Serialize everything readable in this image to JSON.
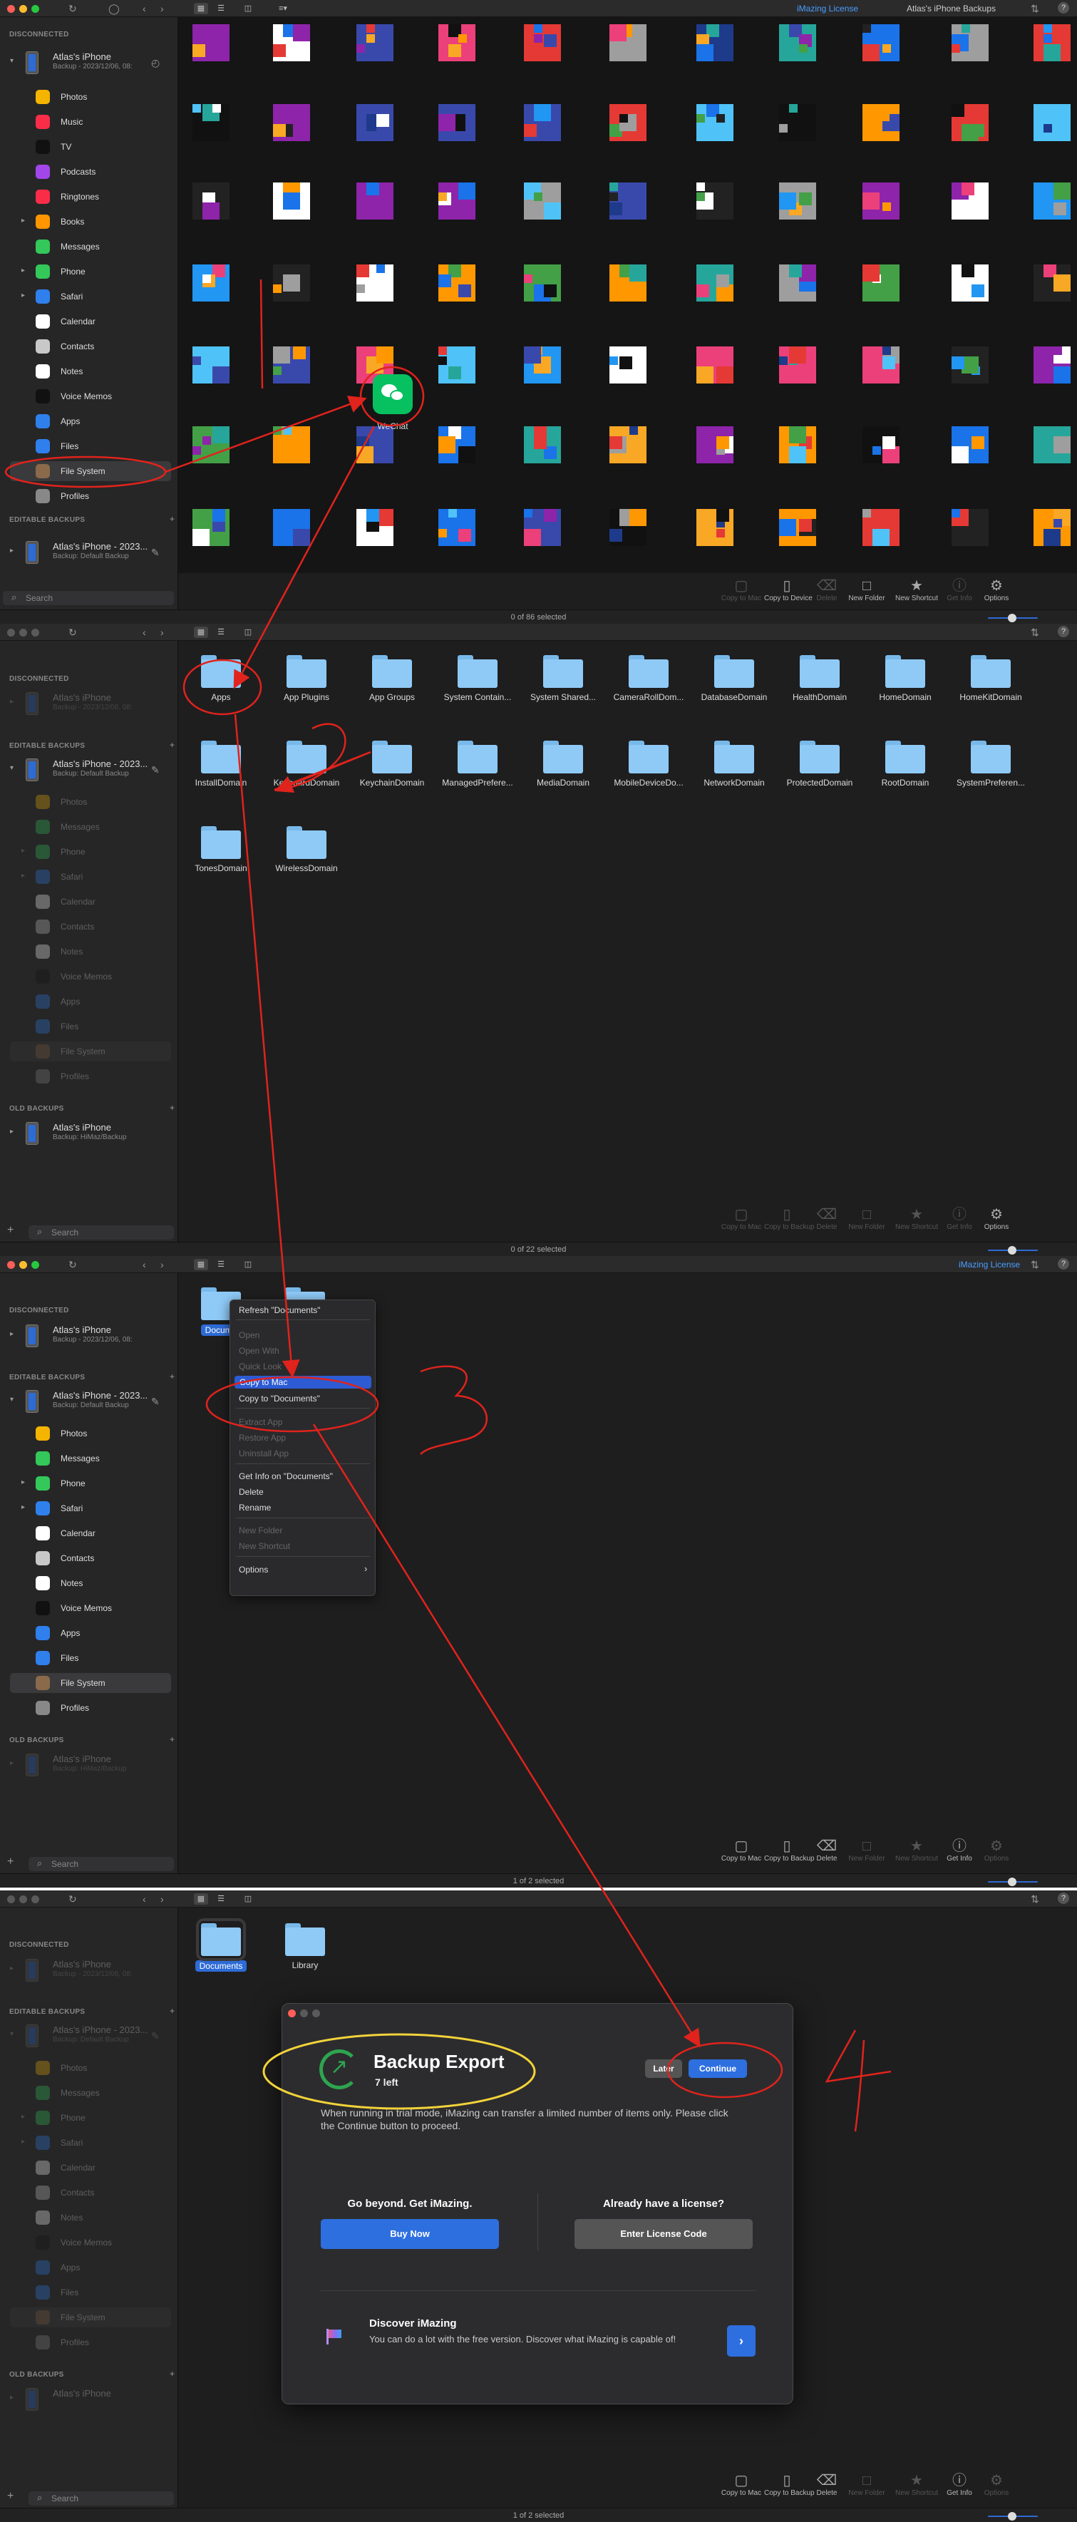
{
  "titlebar": {
    "license_link": "iMazing License",
    "backups_label": "Atlas's iPhone Backups",
    "help": "?"
  },
  "sidebar": {
    "disconnected_header": "DISCONNECTED",
    "editable_header": "EDITABLE BACKUPS",
    "old_header": "OLD BACKUPS",
    "device_name": "Atlas's iPhone",
    "device_sub": "Backup - 2023/12/06, 08:",
    "backup_name": "Atlas's iPhone - 2023...",
    "backup_sub": "Backup: Default Backup",
    "old_name": "Atlas's iPhone",
    "old_sub": "Backup: HiMaz/Backup",
    "search_placeholder": "Search",
    "items_full": [
      "Photos",
      "Music",
      "TV",
      "Podcasts",
      "Ringtones",
      "Books",
      "Messages",
      "Phone",
      "Safari",
      "Calendar",
      "Contacts",
      "Notes",
      "Voice Memos",
      "Apps",
      "Files",
      "File System",
      "Profiles"
    ],
    "items_backup": [
      "Photos",
      "Messages",
      "Phone",
      "Safari",
      "Calendar",
      "Contacts",
      "Notes",
      "Voice Memos",
      "Apps",
      "Files",
      "File System",
      "Profiles"
    ]
  },
  "panel1": {
    "wechat_label": "WeChat",
    "status": "0 of 86 selected"
  },
  "panel2": {
    "folders": [
      "Apps",
      "App Plugins",
      "App Groups",
      "System Contain...",
      "System Shared...",
      "CameraRollDom...",
      "DatabaseDomain",
      "HealthDomain",
      "HomeDomain",
      "HomeKitDomain",
      "InstallDomain",
      "KeyboardDomain",
      "KeychainDomain",
      "ManagedPrefere...",
      "MediaDomain",
      "MobileDeviceDo...",
      "NetworkDomain",
      "ProtectedDomain",
      "RootDomain",
      "SystemPreferen...",
      "TonesDomain",
      "WirelessDomain"
    ],
    "status": "0 of 22 selected"
  },
  "panel3": {
    "selected_folder": "Docume",
    "context_menu": {
      "refresh": "Refresh \"Documents\"",
      "open": "Open",
      "open_with": "Open With",
      "quick_look": "Quick Look",
      "copy_to_mac": "Copy to Mac",
      "copy_to_documents": "Copy to \"Documents\"",
      "extract_app": "Extract App",
      "restore_app": "Restore App",
      "uninstall_app": "Uninstall App",
      "get_info": "Get Info on \"Documents\"",
      "delete": "Delete",
      "rename": "Rename",
      "new_folder": "New Folder",
      "new_shortcut": "New Shortcut",
      "options": "Options"
    },
    "status": "1 of 2 selected"
  },
  "panel4": {
    "folders": [
      "Documents",
      "Library"
    ],
    "status": "1 of 2 selected",
    "dialog": {
      "title": "Backup Export",
      "subtitle": "7 left",
      "later": "Later",
      "continue": "Continue",
      "message": "When running in trial mode, iMazing can transfer a limited number of items only. Please click the Continue button to proceed.",
      "left_heading": "Go beyond. Get iMazing.",
      "buy": "Buy Now",
      "right_heading": "Already have a license?",
      "enter_code": "Enter License Code",
      "discover_title": "Discover iMazing",
      "discover_text": "You can do a lot with the free version. Discover what iMazing is capable of!"
    }
  },
  "toolbar": {
    "copy_to_mac": "Copy to Mac",
    "copy_to_device": "Copy to Device",
    "copy_to_backup": "Copy to Backup",
    "delete": "Delete",
    "new_folder": "New Folder",
    "new_shortcut": "New Shortcut",
    "get_info": "Get Info",
    "options": "Options"
  },
  "annotations": [
    "2",
    "3",
    "4"
  ],
  "colors": {
    "accent": "#2d6bd6",
    "annotation_red": "#e0231c",
    "annotation_yellow": "#f2d33a",
    "window_bg": "#1e1e1f"
  }
}
